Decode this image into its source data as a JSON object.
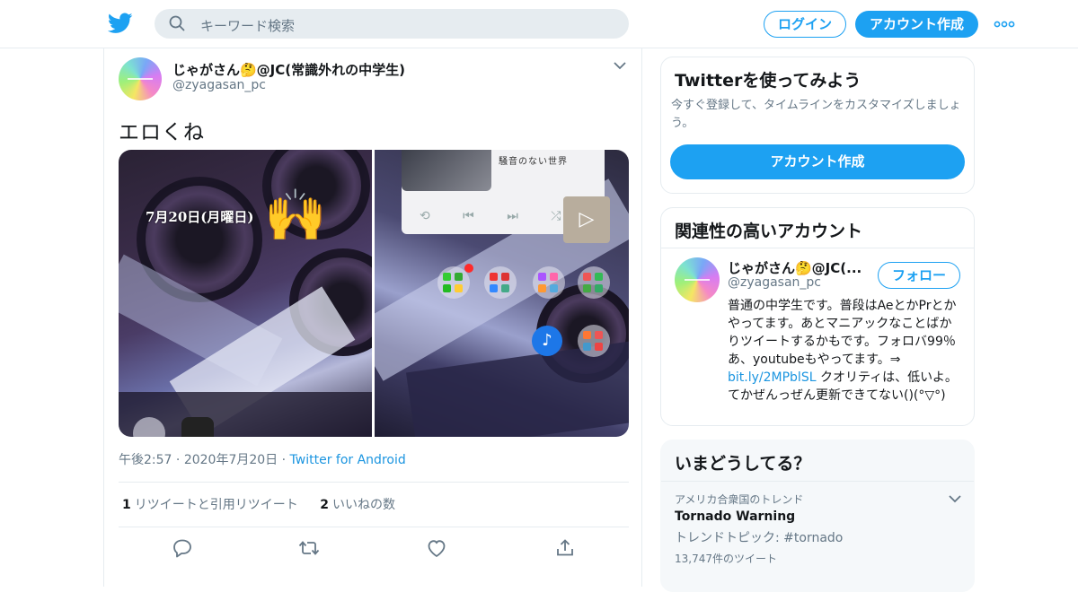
{
  "header": {
    "search_placeholder": "キーワード検索",
    "login_label": "ログイン",
    "signup_label": "アカウント作成",
    "brand_color": "#1da1f2"
  },
  "tweet": {
    "user_name": "じゃがさん🤔@JC(常識外れの中学生)",
    "user_handle": "@zyagasan_pc",
    "text": "エロくね",
    "image1_caption": "7月20日(月曜日)",
    "image1_emoji": "🙌",
    "image2_player_title": "騒音のない世界",
    "image2_controls": "⟲ ⏮ ⏭ ⤮",
    "image2_play": "▷",
    "image2_music": "♪",
    "time": "午後2:57",
    "date": "2020年7月20日",
    "source": "Twitter for Android",
    "retweets_count": "1",
    "retweets_label": "リツイートと引用リツイート",
    "likes_count": "2",
    "likes_label": "いいねの数"
  },
  "sidebar": {
    "signup_card": {
      "title": "Twitterを使ってみよう",
      "description": "今すぐ登録して、タイムラインをカスタマイズしましょう。",
      "button": "アカウント作成"
    },
    "related_card": {
      "title": "関連性の高いアカウント",
      "name": "じゃがさん🤔@JC(...",
      "handle": "@zyagasan_pc",
      "follow_label": "フォロー",
      "bio_before": "普通の中学生です。普段はAeとかPrとかやってます。あとマニアックなことばかりツイートするかもです。フォロバ99％ あ、youtubeもやってます。⇒ ",
      "bio_link": "bit.ly/2MPblSL",
      "bio_after": " クオリティは、低いよ。てかぜんっぜん更新できてない()(°▽°)"
    },
    "trends_card": {
      "title": "いまどうしてる？",
      "trend_location": "アメリカ合衆国のトレンド",
      "trend_name": "Tornado Warning",
      "trend_topic": "トレンドトピック: #tornado",
      "trend_count": "13,747件のツイート"
    }
  }
}
